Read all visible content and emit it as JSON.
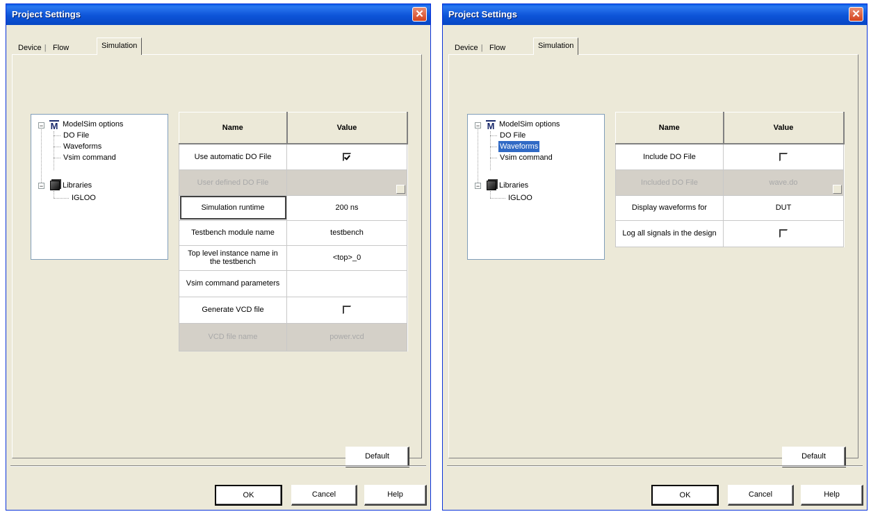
{
  "dialogs": [
    {
      "title": "Project Settings",
      "close_glyph": "✕",
      "tabs": [
        {
          "label": "Device",
          "active": false
        },
        {
          "label": "Flow",
          "active": false
        },
        {
          "label": "Simulation",
          "active": true
        }
      ],
      "tree": {
        "modelsim_label": "ModelSim options",
        "modelsim_children": [
          "DO File",
          "Waveforms",
          "Vsim command"
        ],
        "libraries_label": "Libraries",
        "libraries_children": [
          "IGLOO"
        ],
        "selected": "DO File"
      },
      "grid": {
        "headers": {
          "name": "Name",
          "value": "Value"
        },
        "rows": [
          {
            "name": "Use automatic DO File",
            "value": "",
            "checkbox": true,
            "checked": true
          },
          {
            "name": "User defined DO File",
            "value": "",
            "disabled": true,
            "browse": true
          },
          {
            "name": "Simulation runtime",
            "value": "200 ns",
            "focused": true
          },
          {
            "name": "Testbench module name",
            "value": "testbench"
          },
          {
            "name": "Top level instance name in the testbench",
            "value": "<top>_0"
          },
          {
            "name": "Vsim command parameters",
            "value": ""
          },
          {
            "name": "Generate VCD file",
            "value": "",
            "checkbox": true,
            "checked": false
          },
          {
            "name": "VCD file name",
            "value": "power.vcd",
            "disabled": true
          }
        ]
      },
      "buttons": {
        "default": "Default",
        "ok": "OK",
        "cancel": "Cancel",
        "help": "Help"
      }
    },
    {
      "title": "Project Settings",
      "close_glyph": "✕",
      "tabs": [
        {
          "label": "Device",
          "active": false
        },
        {
          "label": "Flow",
          "active": false
        },
        {
          "label": "Simulation",
          "active": true
        }
      ],
      "tree": {
        "modelsim_label": "ModelSim options",
        "modelsim_children": [
          "DO File",
          "Waveforms",
          "Vsim command"
        ],
        "libraries_label": "Libraries",
        "libraries_children": [
          "IGLOO"
        ],
        "selected": "Waveforms"
      },
      "grid": {
        "headers": {
          "name": "Name",
          "value": "Value"
        },
        "rows": [
          {
            "name": "Include DO File",
            "value": "",
            "checkbox": true,
            "checked": false
          },
          {
            "name": "Included DO File",
            "value": "wave.do",
            "disabled": true,
            "browse": true
          },
          {
            "name": "Display waveforms for",
            "value": "DUT"
          },
          {
            "name": "Log all signals in the design",
            "value": "",
            "checkbox": true,
            "checked": false
          }
        ]
      },
      "buttons": {
        "default": "Default",
        "ok": "OK",
        "cancel": "Cancel",
        "help": "Help"
      }
    }
  ]
}
